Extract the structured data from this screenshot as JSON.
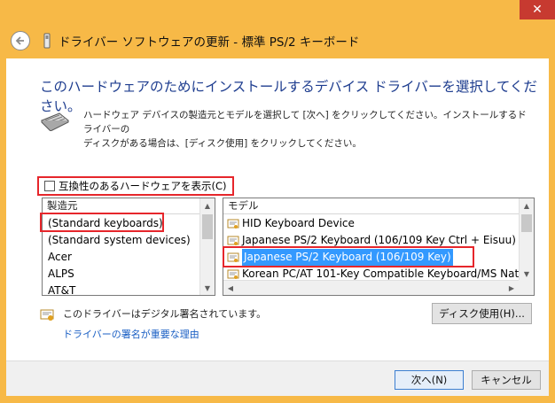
{
  "window": {
    "title": "ドライバー ソフトウェアの更新 - 標準 PS/2 キーボード",
    "close_glyph": "✕"
  },
  "heading": "このハードウェアのためにインストールするデバイス ドライバーを選択してください。",
  "description": [
    "ハードウェア デバイスの製造元とモデルを選択して [次へ] をクリックしてください。インストールするドライバーの",
    "ディスクがある場合は、[ディスク使用] をクリックしてください。"
  ],
  "compat_checkbox": {
    "label": "互換性のあるハードウェアを表示(C)",
    "checked": false
  },
  "manufacturers": {
    "header": "製造元",
    "items": [
      "(Standard keyboards)",
      "(Standard system devices)",
      "Acer",
      "ALPS",
      "AT&T"
    ],
    "selected_index": 0
  },
  "models": {
    "header": "モデル",
    "items": [
      "HID Keyboard Device",
      "Japanese PS/2 Keyboard (106/109 Key Ctrl + Eisuu)",
      "Japanese PS/2 Keyboard (106/109 Key)",
      "Korean PC/AT 101-Key Compatible Keyboard/MS Nat"
    ],
    "selected_index": 2
  },
  "signature": {
    "text": "このドライバーはデジタル署名されています。",
    "link": "ドライバーの署名が重要な理由"
  },
  "buttons": {
    "have_disk": "ディスク使用(H)...",
    "next": "次へ(N)",
    "cancel": "キャンセル"
  },
  "colors": {
    "highlight_box": "#e6262b",
    "selection": "#3399ff",
    "heading": "#1e3d8f",
    "link": "#1a5fc4",
    "frame": "#f7b947"
  },
  "icons": [
    "back-arrow-icon",
    "device-icon",
    "keyboard-icon",
    "driver-icon",
    "certificate-icon",
    "close-icon"
  ]
}
